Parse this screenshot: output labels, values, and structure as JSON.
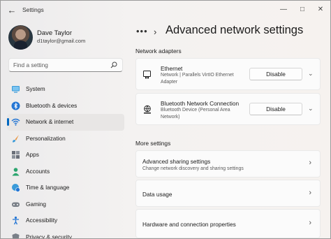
{
  "window": {
    "title": "Settings",
    "back_icon": "back-arrow-icon"
  },
  "profile": {
    "name": "Dave Taylor",
    "email": "d1taylor@gmail.com"
  },
  "search": {
    "placeholder": "Find a setting"
  },
  "sidebar": {
    "items": [
      {
        "label": "System",
        "icon": "monitor-icon",
        "selected": false
      },
      {
        "label": "Bluetooth & devices",
        "icon": "bluetooth-icon",
        "selected": false
      },
      {
        "label": "Network & internet",
        "icon": "wifi-icon",
        "selected": true
      },
      {
        "label": "Personalization",
        "icon": "paintbrush-icon",
        "selected": false
      },
      {
        "label": "Apps",
        "icon": "apps-icon",
        "selected": false
      },
      {
        "label": "Accounts",
        "icon": "person-icon",
        "selected": false
      },
      {
        "label": "Time & language",
        "icon": "globe-clock-icon",
        "selected": false
      },
      {
        "label": "Gaming",
        "icon": "controller-icon",
        "selected": false
      },
      {
        "label": "Accessibility",
        "icon": "accessibility-icon",
        "selected": false
      },
      {
        "label": "Privacy & security",
        "icon": "shield-icon",
        "selected": false
      }
    ]
  },
  "header": {
    "title": "Advanced network settings"
  },
  "adapters": {
    "heading": "Network adapters",
    "items": [
      {
        "name": "Ethernet",
        "description": "Network | Parallels VirtIO Ethernet Adapter",
        "button": "Disable",
        "icon": "ethernet-icon"
      },
      {
        "name": "Bluetooth Network Connection",
        "description": "Bluetooth Device (Personal Area Network)",
        "button": "Disable",
        "icon": "globe-network-icon"
      }
    ]
  },
  "more": {
    "heading": "More settings",
    "items": [
      {
        "title": "Advanced sharing settings",
        "subtitle": "Change network discovery and sharing settings"
      },
      {
        "title": "Data usage",
        "subtitle": ""
      },
      {
        "title": "Hardware and connection properties",
        "subtitle": ""
      }
    ]
  },
  "colors": {
    "accent": "#0067c0",
    "selected_bg": "#e8e6e5",
    "card_bg": "#fbfbfb"
  }
}
